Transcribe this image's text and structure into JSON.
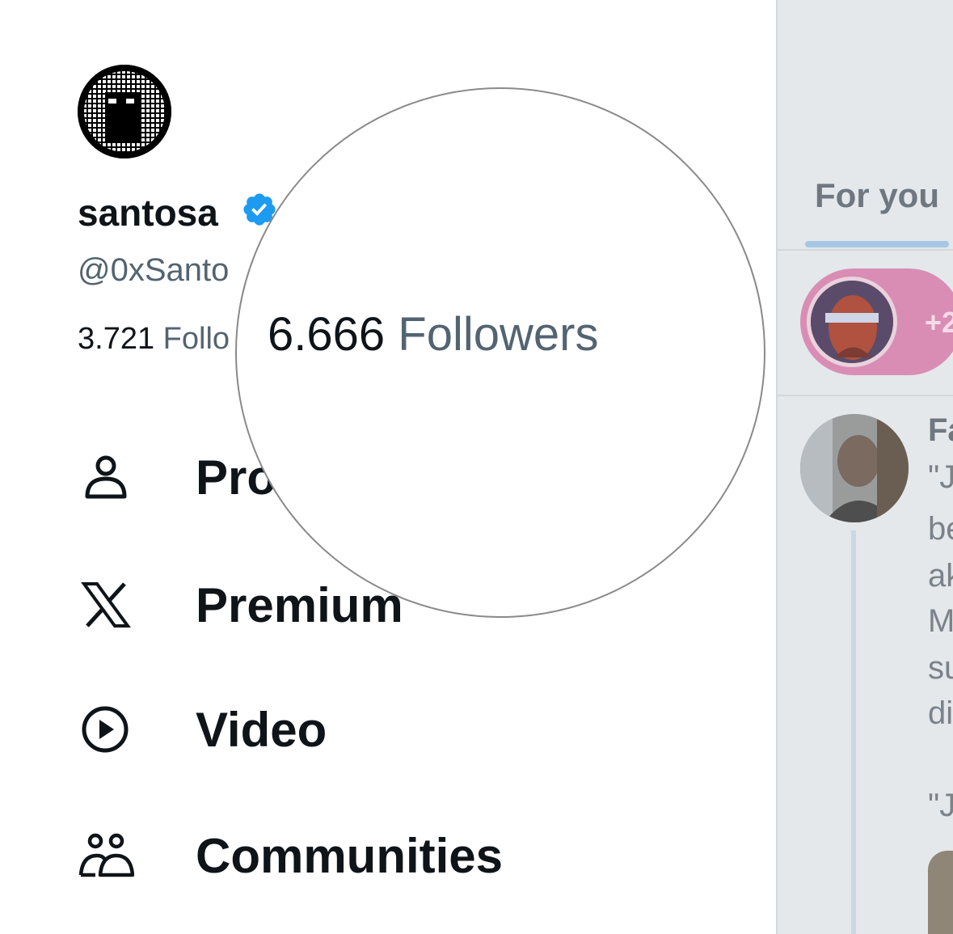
{
  "profile": {
    "display_name": "santosa",
    "handle": "@0xSanto",
    "following_count": "3.721",
    "following_label": "Follo",
    "followers_count": "6.666",
    "followers_label": "Followers"
  },
  "menu": [
    {
      "label": "Pro",
      "icon": "person-icon"
    },
    {
      "label": "Premium",
      "icon": "x-logo-icon"
    },
    {
      "label": "Video",
      "icon": "play-circle-icon"
    },
    {
      "label": "Communities",
      "icon": "communities-icon"
    }
  ],
  "feed": {
    "tab_label": "For you",
    "spaces_count": "+2",
    "post_author": "Fa",
    "post_lines": [
      "\"J",
      "be",
      "ak",
      "M",
      "su",
      "di",
      "",
      "\"J"
    ]
  },
  "colors": {
    "accent": "#1d9bf0",
    "verified": "#1d9bf0",
    "text_primary": "#0f1419",
    "text_secondary": "#536471",
    "overlay_bg": "#e4e8eb"
  }
}
